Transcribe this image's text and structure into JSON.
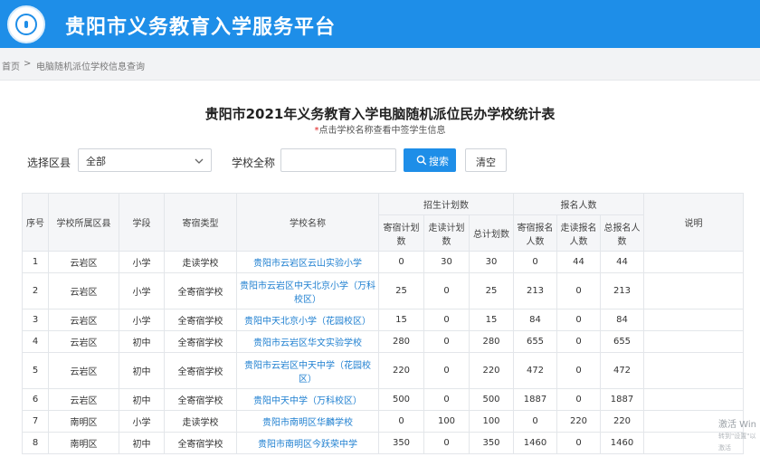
{
  "header": {
    "title": "贵阳市义务教育入学服务平台"
  },
  "breadcrumb": {
    "home": "首页",
    "separator": ">",
    "current": "电脑随机派位学校信息查询"
  },
  "page": {
    "title": "贵阳市2021年义务教育入学电脑随机派位民办学校统计表",
    "notice_star": "*",
    "notice": "点击学校名称查看中签学生信息"
  },
  "filters": {
    "district_label": "选择区县",
    "district_value": "全部",
    "school_label": "学校全称",
    "school_placeholder": "",
    "search_label": "搜索",
    "clear_label": "清空"
  },
  "table": {
    "headers": {
      "index": "序号",
      "district": "学校所属区县",
      "stage": "学段",
      "boarding": "寄宿类型",
      "school": "学校名称",
      "plan_group": "招生计划数",
      "apply_group": "报名人数",
      "plan_boarding": "寄宿计划数",
      "plan_day": "走读计划数",
      "plan_total": "总计划数",
      "apply_boarding": "寄宿报名人数",
      "apply_day": "走读报名人数",
      "apply_total": "总报名人数",
      "note": "说明"
    },
    "rows": [
      {
        "idx": "1",
        "district": "云岩区",
        "stage": "小学",
        "boarding": "走读学校",
        "school": "贵阳市云岩区云山实验小学",
        "pb": "0",
        "pd": "30",
        "pt": "30",
        "ab": "0",
        "ad": "44",
        "at": "44",
        "note": ""
      },
      {
        "idx": "2",
        "district": "云岩区",
        "stage": "小学",
        "boarding": "全寄宿学校",
        "school": "贵阳市云岩区中天北京小学（万科校区）",
        "pb": "25",
        "pd": "0",
        "pt": "25",
        "ab": "213",
        "ad": "0",
        "at": "213",
        "note": ""
      },
      {
        "idx": "3",
        "district": "云岩区",
        "stage": "小学",
        "boarding": "全寄宿学校",
        "school": "贵阳中天北京小学（花园校区）",
        "pb": "15",
        "pd": "0",
        "pt": "15",
        "ab": "84",
        "ad": "0",
        "at": "84",
        "note": ""
      },
      {
        "idx": "4",
        "district": "云岩区",
        "stage": "初中",
        "boarding": "全寄宿学校",
        "school": "贵阳市云岩区华文实验学校",
        "pb": "280",
        "pd": "0",
        "pt": "280",
        "ab": "655",
        "ad": "0",
        "at": "655",
        "note": ""
      },
      {
        "idx": "5",
        "district": "云岩区",
        "stage": "初中",
        "boarding": "全寄宿学校",
        "school": "贵阳市云岩区中天中学（花园校区）",
        "pb": "220",
        "pd": "0",
        "pt": "220",
        "ab": "472",
        "ad": "0",
        "at": "472",
        "note": ""
      },
      {
        "idx": "6",
        "district": "云岩区",
        "stage": "初中",
        "boarding": "全寄宿学校",
        "school": "贵阳中天中学（万科校区）",
        "pb": "500",
        "pd": "0",
        "pt": "500",
        "ab": "1887",
        "ad": "0",
        "at": "1887",
        "note": ""
      },
      {
        "idx": "7",
        "district": "南明区",
        "stage": "小学",
        "boarding": "走读学校",
        "school": "贵阳市南明区华麟学校",
        "pb": "0",
        "pd": "100",
        "pt": "100",
        "ab": "0",
        "ad": "220",
        "at": "220",
        "note": ""
      },
      {
        "idx": "8",
        "district": "南明区",
        "stage": "初中",
        "boarding": "全寄宿学校",
        "school": "贵阳市南明区今跃荣中学",
        "pb": "350",
        "pd": "0",
        "pt": "350",
        "ab": "1460",
        "ad": "0",
        "at": "1460",
        "note": ""
      }
    ]
  },
  "watermark": {
    "line1": "激活 Win",
    "line2": "转到\"设置\"以激活"
  }
}
